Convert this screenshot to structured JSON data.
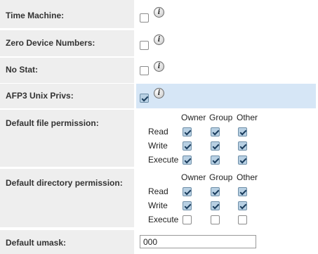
{
  "rows": {
    "time_machine": {
      "label": "Time Machine:",
      "checked": false
    },
    "zero_device_numbers": {
      "label": "Zero Device Numbers:",
      "checked": false
    },
    "no_stat": {
      "label": "No Stat:",
      "checked": false
    },
    "afp3_unix_privs": {
      "label": "AFP3 Unix Privs:",
      "checked": true
    }
  },
  "info_glyph": "i",
  "matrix_headers": [
    "Owner",
    "Group",
    "Other"
  ],
  "matrix_rows": [
    "Read",
    "Write",
    "Execute"
  ],
  "default_file_permission": {
    "label": "Default file permission:",
    "checked": [
      [
        true,
        true,
        true
      ],
      [
        true,
        true,
        true
      ],
      [
        true,
        true,
        true
      ]
    ]
  },
  "default_directory_permission": {
    "label": "Default directory permission:",
    "checked": [
      [
        true,
        true,
        true
      ],
      [
        true,
        true,
        true
      ],
      [
        false,
        false,
        false
      ]
    ]
  },
  "default_umask": {
    "label": "Default umask:",
    "value": "000"
  },
  "colors": {
    "label_bg": "#eeeeee",
    "highlight_bg": "#d6e6f6",
    "checked_bg": "#b8d0e3"
  }
}
